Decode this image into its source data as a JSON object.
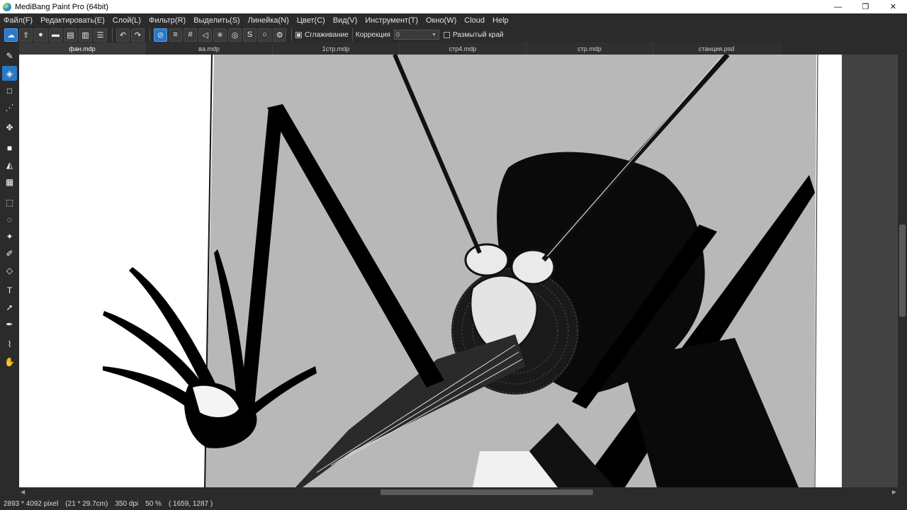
{
  "window": {
    "title": "MediBang Paint Pro (64bit)",
    "controls": {
      "minimize": "—",
      "restore": "❐",
      "close": "✕"
    }
  },
  "menu": [
    "Файл(F)",
    "Редактировать(E)",
    "Слой(L)",
    "Фильтр(R)",
    "Выделить(S)",
    "Линейка(N)",
    "Цвет(C)",
    "Вид(V)",
    "Инструмент(T)",
    "Окно(W)",
    "Cloud",
    "Help"
  ],
  "toolbar": {
    "antialias_label": "Сглаживание",
    "correction_label": "Коррекция",
    "correction_value": "0",
    "blur_edge_label": "Размытый край"
  },
  "tabs": [
    "фан.mdp",
    "ва.mdp",
    "1стр.mdp",
    "стр4.mdp",
    "стр.mdp",
    "станция.psd"
  ],
  "status": {
    "size": "2893 * 4092 pixel",
    "physical": "(21 * 29.7cm)",
    "dpi": "350 dpi",
    "zoom": "50 %",
    "cursor": "( 1659, 1287 )"
  },
  "colors": {
    "accent": "#2a78c8",
    "canvas_gray": "#b8b8b8",
    "panel": "#2b2b2b"
  },
  "icons": {
    "tools": [
      "brush-icon",
      "eraser-icon",
      "rectangle-icon",
      "dot-icon",
      "move-icon",
      "fill-rect-icon",
      "bucket-icon",
      "gradient-icon",
      "select-rect-icon",
      "lasso-icon",
      "magic-wand-icon",
      "select-pen-icon",
      "select-eraser-icon",
      "text-icon",
      "operation-icon",
      "eyedropper-icon",
      "dropper-icon",
      "hand-icon"
    ]
  }
}
